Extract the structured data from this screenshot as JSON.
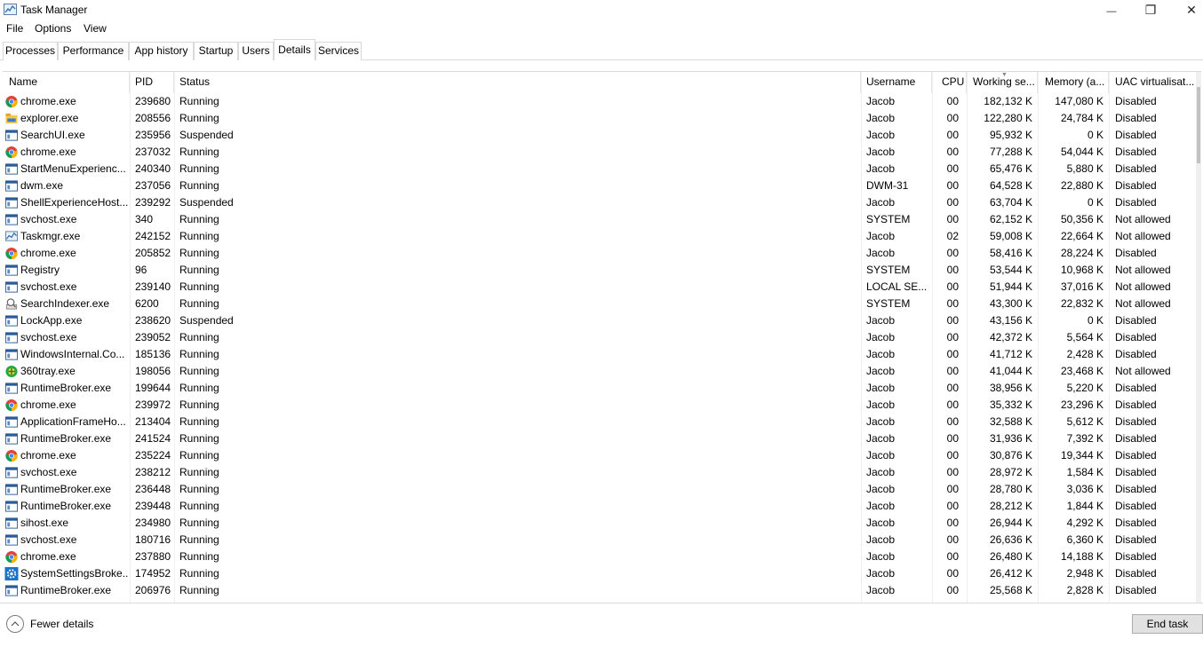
{
  "window": {
    "title": "Task Manager",
    "minimize_glyph": "—",
    "restore_glyph": "❐",
    "close_glyph": "✕"
  },
  "menu": [
    "File",
    "Options",
    "View"
  ],
  "tabs": [
    "Processes",
    "Performance",
    "App history",
    "Startup",
    "Users",
    "Details",
    "Services"
  ],
  "active_tab": "Details",
  "columns": [
    "Name",
    "PID",
    "Status",
    "Username",
    "CPU",
    "Working se...",
    "Memory (a...",
    "UAC virtualisat..."
  ],
  "sorted_column": "Working se...",
  "rows": [
    {
      "icon": "chrome-icon",
      "name": "chrome.exe",
      "pid": "239680",
      "status": "Running",
      "user": "Jacob",
      "cpu": "00",
      "ws": "182,132 K",
      "mem": "147,080 K",
      "uac": "Disabled"
    },
    {
      "icon": "explorer-icon",
      "name": "explorer.exe",
      "pid": "208556",
      "status": "Running",
      "user": "Jacob",
      "cpu": "00",
      "ws": "122,280 K",
      "mem": "24,784 K",
      "uac": "Disabled"
    },
    {
      "icon": "window-icon",
      "name": "SearchUI.exe",
      "pid": "235956",
      "status": "Suspended",
      "user": "Jacob",
      "cpu": "00",
      "ws": "95,932 K",
      "mem": "0 K",
      "uac": "Disabled"
    },
    {
      "icon": "chrome-icon",
      "name": "chrome.exe",
      "pid": "237032",
      "status": "Running",
      "user": "Jacob",
      "cpu": "00",
      "ws": "77,288 K",
      "mem": "54,044 K",
      "uac": "Disabled"
    },
    {
      "icon": "window-icon",
      "name": "StartMenuExperienc...",
      "pid": "240340",
      "status": "Running",
      "user": "Jacob",
      "cpu": "00",
      "ws": "65,476 K",
      "mem": "5,880 K",
      "uac": "Disabled"
    },
    {
      "icon": "window-icon",
      "name": "dwm.exe",
      "pid": "237056",
      "status": "Running",
      "user": "DWM-31",
      "cpu": "00",
      "ws": "64,528 K",
      "mem": "22,880 K",
      "uac": "Disabled"
    },
    {
      "icon": "window-icon",
      "name": "ShellExperienceHost....",
      "pid": "239292",
      "status": "Suspended",
      "user": "Jacob",
      "cpu": "00",
      "ws": "63,704 K",
      "mem": "0 K",
      "uac": "Disabled"
    },
    {
      "icon": "window-icon",
      "name": "svchost.exe",
      "pid": "340",
      "status": "Running",
      "user": "SYSTEM",
      "cpu": "00",
      "ws": "62,152 K",
      "mem": "50,356 K",
      "uac": "Not allowed"
    },
    {
      "icon": "taskmgr-icon",
      "name": "Taskmgr.exe",
      "pid": "242152",
      "status": "Running",
      "user": "Jacob",
      "cpu": "02",
      "ws": "59,008 K",
      "mem": "22,664 K",
      "uac": "Not allowed"
    },
    {
      "icon": "chrome-icon",
      "name": "chrome.exe",
      "pid": "205852",
      "status": "Running",
      "user": "Jacob",
      "cpu": "00",
      "ws": "58,416 K",
      "mem": "28,224 K",
      "uac": "Disabled"
    },
    {
      "icon": "window-icon",
      "name": "Registry",
      "pid": "96",
      "status": "Running",
      "user": "SYSTEM",
      "cpu": "00",
      "ws": "53,544 K",
      "mem": "10,968 K",
      "uac": "Not allowed"
    },
    {
      "icon": "window-icon",
      "name": "svchost.exe",
      "pid": "239140",
      "status": "Running",
      "user": "LOCAL SE...",
      "cpu": "00",
      "ws": "51,944 K",
      "mem": "37,016 K",
      "uac": "Not allowed"
    },
    {
      "icon": "indexer-icon",
      "name": "SearchIndexer.exe",
      "pid": "6200",
      "status": "Running",
      "user": "SYSTEM",
      "cpu": "00",
      "ws": "43,300 K",
      "mem": "22,832 K",
      "uac": "Not allowed"
    },
    {
      "icon": "window-icon",
      "name": "LockApp.exe",
      "pid": "238620",
      "status": "Suspended",
      "user": "Jacob",
      "cpu": "00",
      "ws": "43,156 K",
      "mem": "0 K",
      "uac": "Disabled"
    },
    {
      "icon": "window-icon",
      "name": "svchost.exe",
      "pid": "239052",
      "status": "Running",
      "user": "Jacob",
      "cpu": "00",
      "ws": "42,372 K",
      "mem": "5,564 K",
      "uac": "Disabled"
    },
    {
      "icon": "window-icon",
      "name": "WindowsInternal.Co...",
      "pid": "185136",
      "status": "Running",
      "user": "Jacob",
      "cpu": "00",
      "ws": "41,712 K",
      "mem": "2,428 K",
      "uac": "Disabled"
    },
    {
      "icon": "tray360-icon",
      "name": "360tray.exe",
      "pid": "198056",
      "status": "Running",
      "user": "Jacob",
      "cpu": "00",
      "ws": "41,044 K",
      "mem": "23,468 K",
      "uac": "Not allowed"
    },
    {
      "icon": "window-icon",
      "name": "RuntimeBroker.exe",
      "pid": "199644",
      "status": "Running",
      "user": "Jacob",
      "cpu": "00",
      "ws": "38,956 K",
      "mem": "5,220 K",
      "uac": "Disabled"
    },
    {
      "icon": "chrome-icon",
      "name": "chrome.exe",
      "pid": "239972",
      "status": "Running",
      "user": "Jacob",
      "cpu": "00",
      "ws": "35,332 K",
      "mem": "23,296 K",
      "uac": "Disabled"
    },
    {
      "icon": "window-icon",
      "name": "ApplicationFrameHo...",
      "pid": "213404",
      "status": "Running",
      "user": "Jacob",
      "cpu": "00",
      "ws": "32,588 K",
      "mem": "5,612 K",
      "uac": "Disabled"
    },
    {
      "icon": "window-icon",
      "name": "RuntimeBroker.exe",
      "pid": "241524",
      "status": "Running",
      "user": "Jacob",
      "cpu": "00",
      "ws": "31,936 K",
      "mem": "7,392 K",
      "uac": "Disabled"
    },
    {
      "icon": "chrome-icon",
      "name": "chrome.exe",
      "pid": "235224",
      "status": "Running",
      "user": "Jacob",
      "cpu": "00",
      "ws": "30,876 K",
      "mem": "19,344 K",
      "uac": "Disabled"
    },
    {
      "icon": "window-icon",
      "name": "svchost.exe",
      "pid": "238212",
      "status": "Running",
      "user": "Jacob",
      "cpu": "00",
      "ws": "28,972 K",
      "mem": "1,584 K",
      "uac": "Disabled"
    },
    {
      "icon": "window-icon",
      "name": "RuntimeBroker.exe",
      "pid": "236448",
      "status": "Running",
      "user": "Jacob",
      "cpu": "00",
      "ws": "28,780 K",
      "mem": "3,036 K",
      "uac": "Disabled"
    },
    {
      "icon": "window-icon",
      "name": "RuntimeBroker.exe",
      "pid": "239448",
      "status": "Running",
      "user": "Jacob",
      "cpu": "00",
      "ws": "28,212 K",
      "mem": "1,844 K",
      "uac": "Disabled"
    },
    {
      "icon": "window-icon",
      "name": "sihost.exe",
      "pid": "234980",
      "status": "Running",
      "user": "Jacob",
      "cpu": "00",
      "ws": "26,944 K",
      "mem": "4,292 K",
      "uac": "Disabled"
    },
    {
      "icon": "window-icon",
      "name": "svchost.exe",
      "pid": "180716",
      "status": "Running",
      "user": "Jacob",
      "cpu": "00",
      "ws": "26,636 K",
      "mem": "6,360 K",
      "uac": "Disabled"
    },
    {
      "icon": "chrome-icon",
      "name": "chrome.exe",
      "pid": "237880",
      "status": "Running",
      "user": "Jacob",
      "cpu": "00",
      "ws": "26,480 K",
      "mem": "14,188 K",
      "uac": "Disabled"
    },
    {
      "icon": "gear-icon",
      "name": "SystemSettingsBroke...",
      "pid": "174952",
      "status": "Running",
      "user": "Jacob",
      "cpu": "00",
      "ws": "26,412 K",
      "mem": "2,948 K",
      "uac": "Disabled"
    },
    {
      "icon": "window-icon",
      "name": "RuntimeBroker.exe",
      "pid": "206976",
      "status": "Running",
      "user": "Jacob",
      "cpu": "00",
      "ws": "25,568 K",
      "mem": "2,828 K",
      "uac": "Disabled"
    }
  ],
  "footer": {
    "fewer_details": "Fewer details",
    "end_task": "End task"
  }
}
